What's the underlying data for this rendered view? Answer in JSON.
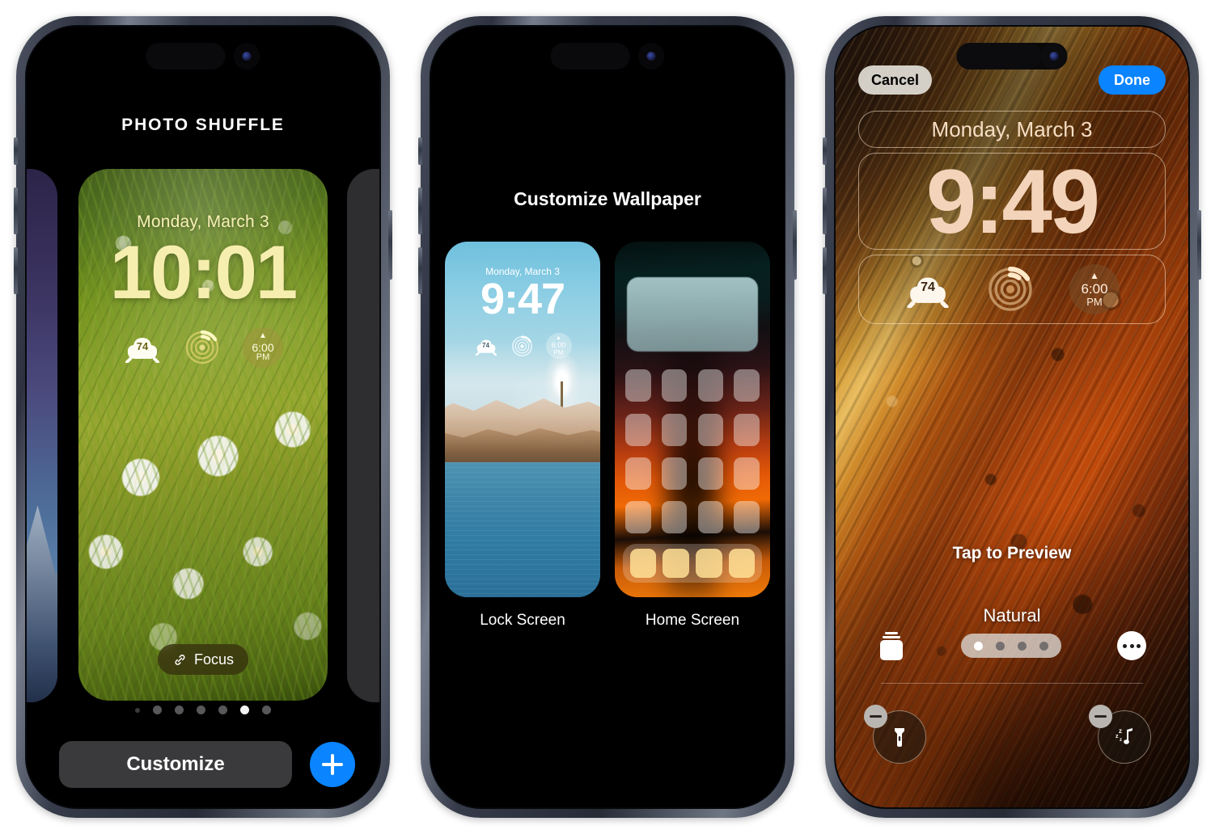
{
  "phone1": {
    "header": "PHOTO SHUFFLE",
    "lock_screen": {
      "date": "Monday, March 3",
      "time": "10:01",
      "widgets": {
        "weather_temp": "74",
        "rings_icon": "activity-rings-icon",
        "sunset_time": "6:00",
        "sunset_ampm": "PM",
        "sunset_icon": "sunset-icon"
      },
      "focus_label": "Focus",
      "focus_icon": "link-icon"
    },
    "page_dots": {
      "count": 7,
      "active_index": 5
    },
    "customize_label": "Customize",
    "add_label": "add-wallpaper-plus-icon",
    "accent_blue": "#0a84ff"
  },
  "phone2": {
    "header": "Customize Wallpaper",
    "previews": [
      {
        "label": "Lock Screen",
        "date": "Monday, March 3",
        "time": "9:47",
        "widgets": {
          "weather_temp": "74",
          "sunset_time": "6:00",
          "sunset_ampm": "PM"
        }
      },
      {
        "label": "Home Screen",
        "icon_rows": 4,
        "icon_cols": 4,
        "dock_icons": 4
      }
    ]
  },
  "phone3": {
    "cancel_label": "Cancel",
    "done_label": "Done",
    "date": "Monday, March 3",
    "time": "9:49",
    "widgets": {
      "weather_temp": "74",
      "rings_icon": "activity-rings-icon",
      "sunset_time": "6:00",
      "sunset_ampm": "PM",
      "sunset_icon": "sunset-icon"
    },
    "tap_to_preview": "Tap to Preview",
    "filter_name": "Natural",
    "style_dots": {
      "count": 4,
      "active_index": 0
    },
    "stack_icon": "photo-stack-icon",
    "more_icon": "more-ellipsis-icon",
    "controls": [
      {
        "name": "flashlight",
        "icon": "flashlight-icon",
        "remove_badge": "minus-icon"
      },
      {
        "name": "sleep-music",
        "icon": "sleep-music-note-icon",
        "remove_badge": "minus-icon"
      }
    ],
    "accent_blue": "#0a84ff",
    "cancel_bg": "#e2ded7"
  }
}
